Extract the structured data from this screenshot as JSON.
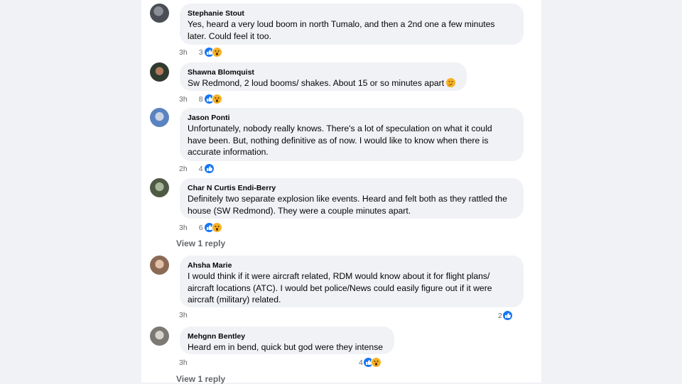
{
  "comments": [
    {
      "author": "Stephanie Stout",
      "text": "Yes, heard a very loud boom in north Tumalo, and then a 2nd one a few minutes\nlater. Could feel it too.",
      "time": "3h",
      "reactions": "3"
    },
    {
      "author": "Shawna Blomquist",
      "text": "Sw Redmond, 2 loud booms/ shakes. About 15 or so minutes apart",
      "time": "3h",
      "reactions": "8"
    },
    {
      "author": "Jason Ponti",
      "text": "Unfortunately, nobody really knows. There's a lot of speculation on what it could\nhave been. But, nothing definitive as of now. I would like to know when there is\naccurate information.",
      "time": "2h",
      "reactions": "4"
    },
    {
      "author": "Char N Curtis Endi-Berry",
      "text": "Definitely two separate explosion like events. Heard and felt both as they rattled the\nhouse (SW Redmond). They were a couple minutes apart.",
      "time": "3h",
      "reactions": "6",
      "reply_link": "View 1 reply"
    },
    {
      "author": "Ahsha Marie",
      "text": "I would think if it were aircraft related, RDM would know about it for flight plans/\naircraft locations (ATC). I would bet police/News could easily figure out if it were\naircraft (military) related.",
      "time": "3h",
      "reactions": "2"
    },
    {
      "author": "Mehgnn Bentley",
      "text": "Heard em in bend, quick but god were they intense",
      "time": "3h",
      "reactions": "4",
      "reply_link": "View 1 reply"
    }
  ],
  "icons": {
    "like": "like-reaction-icon",
    "wow": "wow-reaction-icon",
    "thinking": "thinking-emoji-icon"
  },
  "colors": {
    "like_blue": "#1877f2",
    "wow_yellow": "#f7b125",
    "bubble_bg": "#f0f2f5"
  }
}
